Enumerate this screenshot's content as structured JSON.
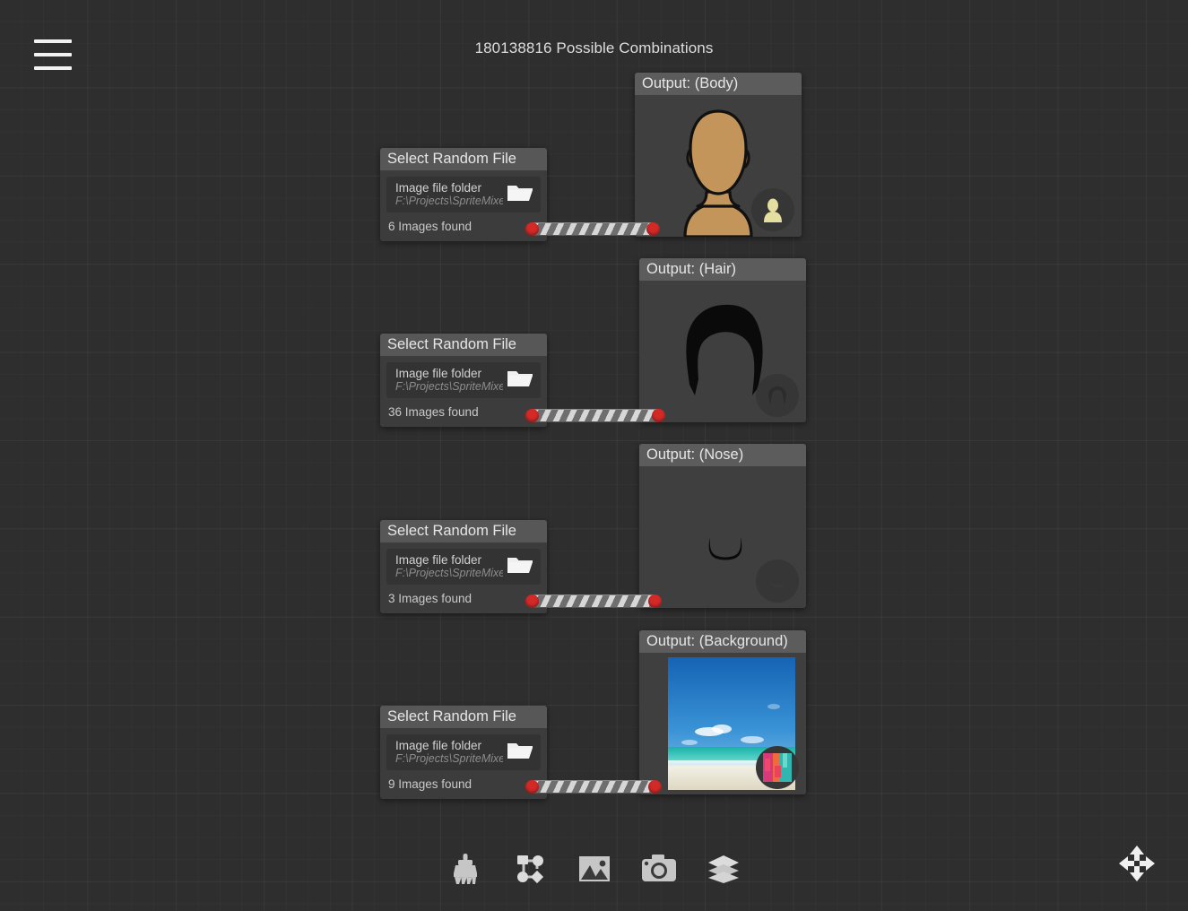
{
  "app": {
    "title": "180138816 Possible Combinations",
    "menu_icon": "hamburger-menu-icon",
    "pan_icon": "move-arrows-icon"
  },
  "nodes": {
    "select_random_file": [
      {
        "title": "Select Random File",
        "field_label": "Image file folder",
        "field_value": "F:\\Projects\\SpriteMixe",
        "folder_icon": "folder-icon",
        "images_found": "6 Images found"
      },
      {
        "title": "Select Random File",
        "field_label": "Image file folder",
        "field_value": "F:\\Projects\\SpriteMixe",
        "folder_icon": "folder-icon",
        "images_found": "36 Images found"
      },
      {
        "title": "Select Random File",
        "field_label": "Image file folder",
        "field_value": "F:\\Projects\\SpriteMixe",
        "folder_icon": "folder-icon",
        "images_found": "3 Images found"
      },
      {
        "title": "Select Random File",
        "field_label": "Image file folder",
        "field_value": "F:\\Projects\\SpriteMixe",
        "folder_icon": "folder-icon",
        "images_found": "9 Images found"
      }
    ],
    "outputs": [
      {
        "title": "Output: (Body)",
        "preview": "body-silhouette",
        "thumb": "person-thumbnail"
      },
      {
        "title": "Output: (Hair)",
        "preview": "hair-shape",
        "thumb": "hair-thumbnail"
      },
      {
        "title": "Output: (Nose)",
        "preview": "nose-shape",
        "thumb": "nose-thumbnail"
      },
      {
        "title": "Output: (Background)",
        "preview": "beach-photo",
        "thumb": "abstract-thumbnail"
      }
    ]
  },
  "toolbar": {
    "items": [
      {
        "name": "paintbrush-icon",
        "label": "Paint"
      },
      {
        "name": "node-graph-icon",
        "label": "Nodes"
      },
      {
        "name": "image-icon",
        "label": "Image"
      },
      {
        "name": "camera-icon",
        "label": "Camera"
      },
      {
        "name": "layers-icon",
        "label": "Layers"
      }
    ]
  },
  "colors": {
    "canvas": "#2e2e2e",
    "node_body": "#3c3c3c",
    "node_header": "#5a5a5a",
    "plug": "#d32a28",
    "skin": "#c3955a",
    "hair": "#0a0a0a"
  }
}
